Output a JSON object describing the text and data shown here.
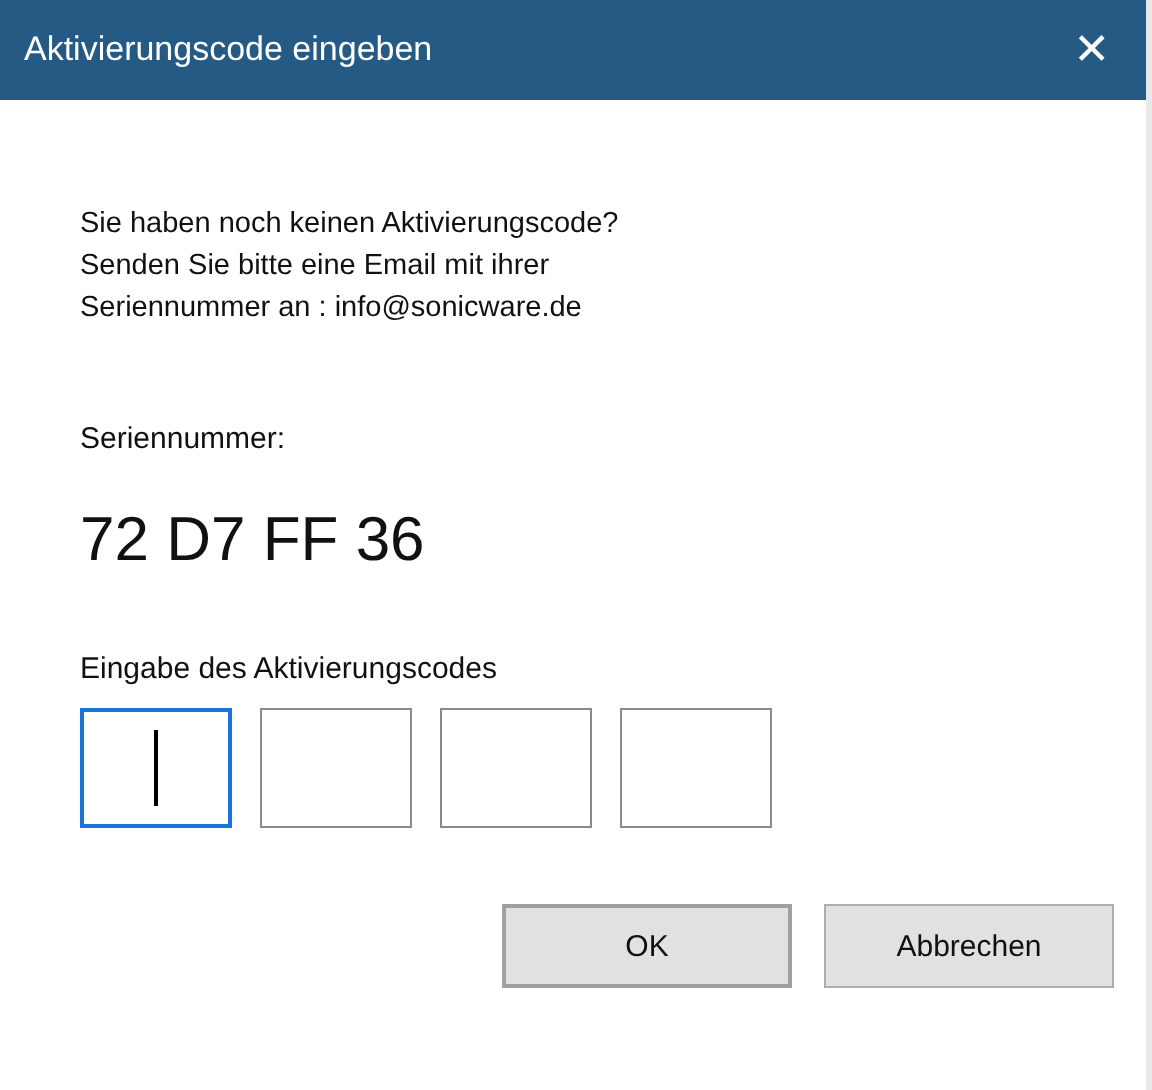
{
  "window": {
    "title": "Aktivierungscode eingeben",
    "close": "✕"
  },
  "info": [
    "Sie haben noch keinen Aktivierungscode?",
    "Senden Sie bitte eine Email mit ihrer",
    "Seriennummer an : info@sonicware.de"
  ],
  "serial": {
    "label": "Seriennummer:",
    "value": "72 D7 FF 36"
  },
  "code": {
    "label": "Eingabe des Aktivierungscodes",
    "fields": [
      {
        "focused": true
      },
      {
        "focused": false
      },
      {
        "focused": false
      },
      {
        "focused": false
      }
    ]
  },
  "buttons": [
    {
      "label": "OK",
      "kind": "default"
    },
    {
      "label": "Abbrechen",
      "kind": "normal"
    }
  ]
}
